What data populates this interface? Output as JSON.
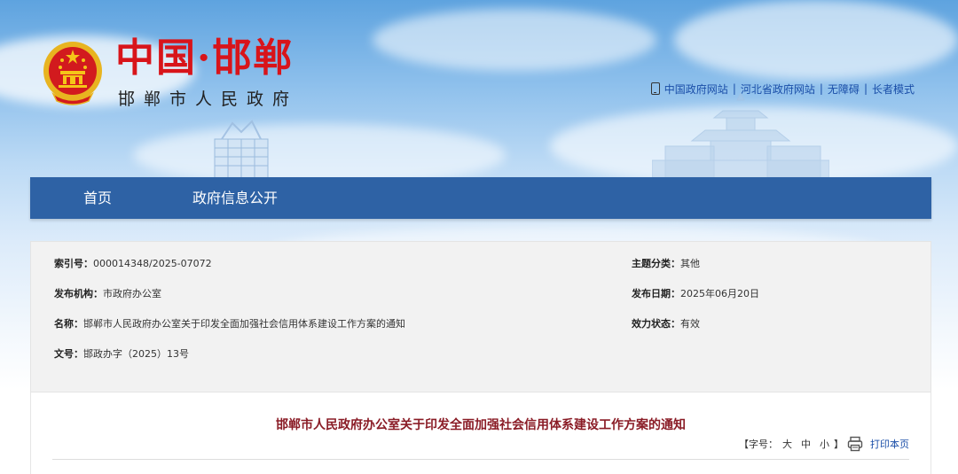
{
  "header": {
    "logo_main": "中国·邯郸",
    "logo_sub": "邯郸市人民政府",
    "links": [
      "中国政府网站",
      "河北省政府网站",
      "无障碍",
      "长者模式"
    ]
  },
  "nav": {
    "items": [
      "首页",
      "政府信息公开"
    ]
  },
  "meta": {
    "index_label": "索引号：",
    "index_value": "000014348/2025-07072",
    "topic_label": "主题分类：",
    "topic_value": "其他",
    "org_label": "发布机构：",
    "org_value": "市政府办公室",
    "date_label": "发布日期：",
    "date_value": "2025年06月20日",
    "name_label": "名称：",
    "name_value": "邯郸市人民政府办公室关于印发全面加强社会信用体系建设工作方案的通知",
    "status_label": "效力状态：",
    "status_value": "有效",
    "docno_label": "文号：",
    "docno_value": "邯政办字（2025）13号"
  },
  "article": {
    "title": "邯郸市人民政府办公室关于印发全面加强社会信用体系建设工作方案的通知",
    "font_label": "【字号：",
    "font_large": "大",
    "font_medium": "中",
    "font_small": "小",
    "font_close": "】",
    "print_label": "打印本页"
  },
  "colors": {
    "nav_bg": "#2e62a5",
    "logo_red": "#d8141a",
    "title_red": "#8a1c26",
    "link_blue": "#1a4ea8"
  }
}
